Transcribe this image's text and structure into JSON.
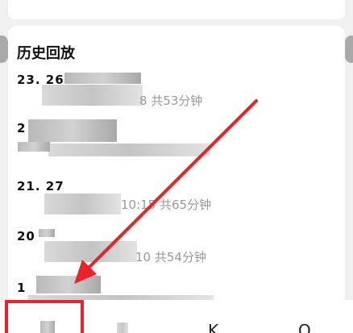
{
  "section": {
    "title": "历史回放"
  },
  "replays": [
    {
      "title": "23. 26",
      "meta": "8 共53分钟"
    },
    {
      "title": "2",
      "meta": ""
    },
    {
      "title": "21. 27",
      "meta": "10:15 共65分钟"
    },
    {
      "title": "20",
      "meta": "10 共54分钟"
    },
    {
      "title": "1",
      "meta": ""
    }
  ],
  "bottom_nav": {
    "items": [
      "",
      "",
      "K",
      "Q"
    ]
  },
  "colors": {
    "annotation": "#e8232a",
    "meta": "#9a9a9a"
  }
}
